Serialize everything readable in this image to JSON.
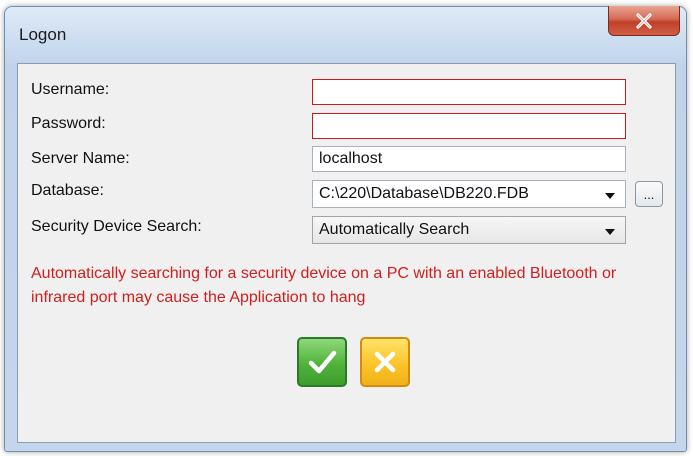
{
  "window": {
    "title": "Logon",
    "close_icon": "close-icon"
  },
  "form": {
    "username_label": "Username:",
    "username_value": "",
    "password_label": "Password:",
    "password_value": "",
    "server_label": "Server Name:",
    "server_value": "localhost",
    "database_label": "Database:",
    "database_value": "C:\\220\\Database\\DB220.FDB",
    "browse_label": "...",
    "security_label": "Security Device Search:",
    "security_value": "Automatically Search"
  },
  "warning": {
    "text": "Automatically searching for a security device on a PC with an enabled Bluetooth or infrared port may cause the Application to hang"
  },
  "buttons": {
    "ok_icon": "checkmark-icon",
    "cancel_icon": "x-icon"
  },
  "colors": {
    "warning": "#d41d1d",
    "required_border": "#d01818",
    "ok_green": "#4fb33a",
    "cancel_yellow": "#fbc42a",
    "close_red": "#c0402a"
  }
}
